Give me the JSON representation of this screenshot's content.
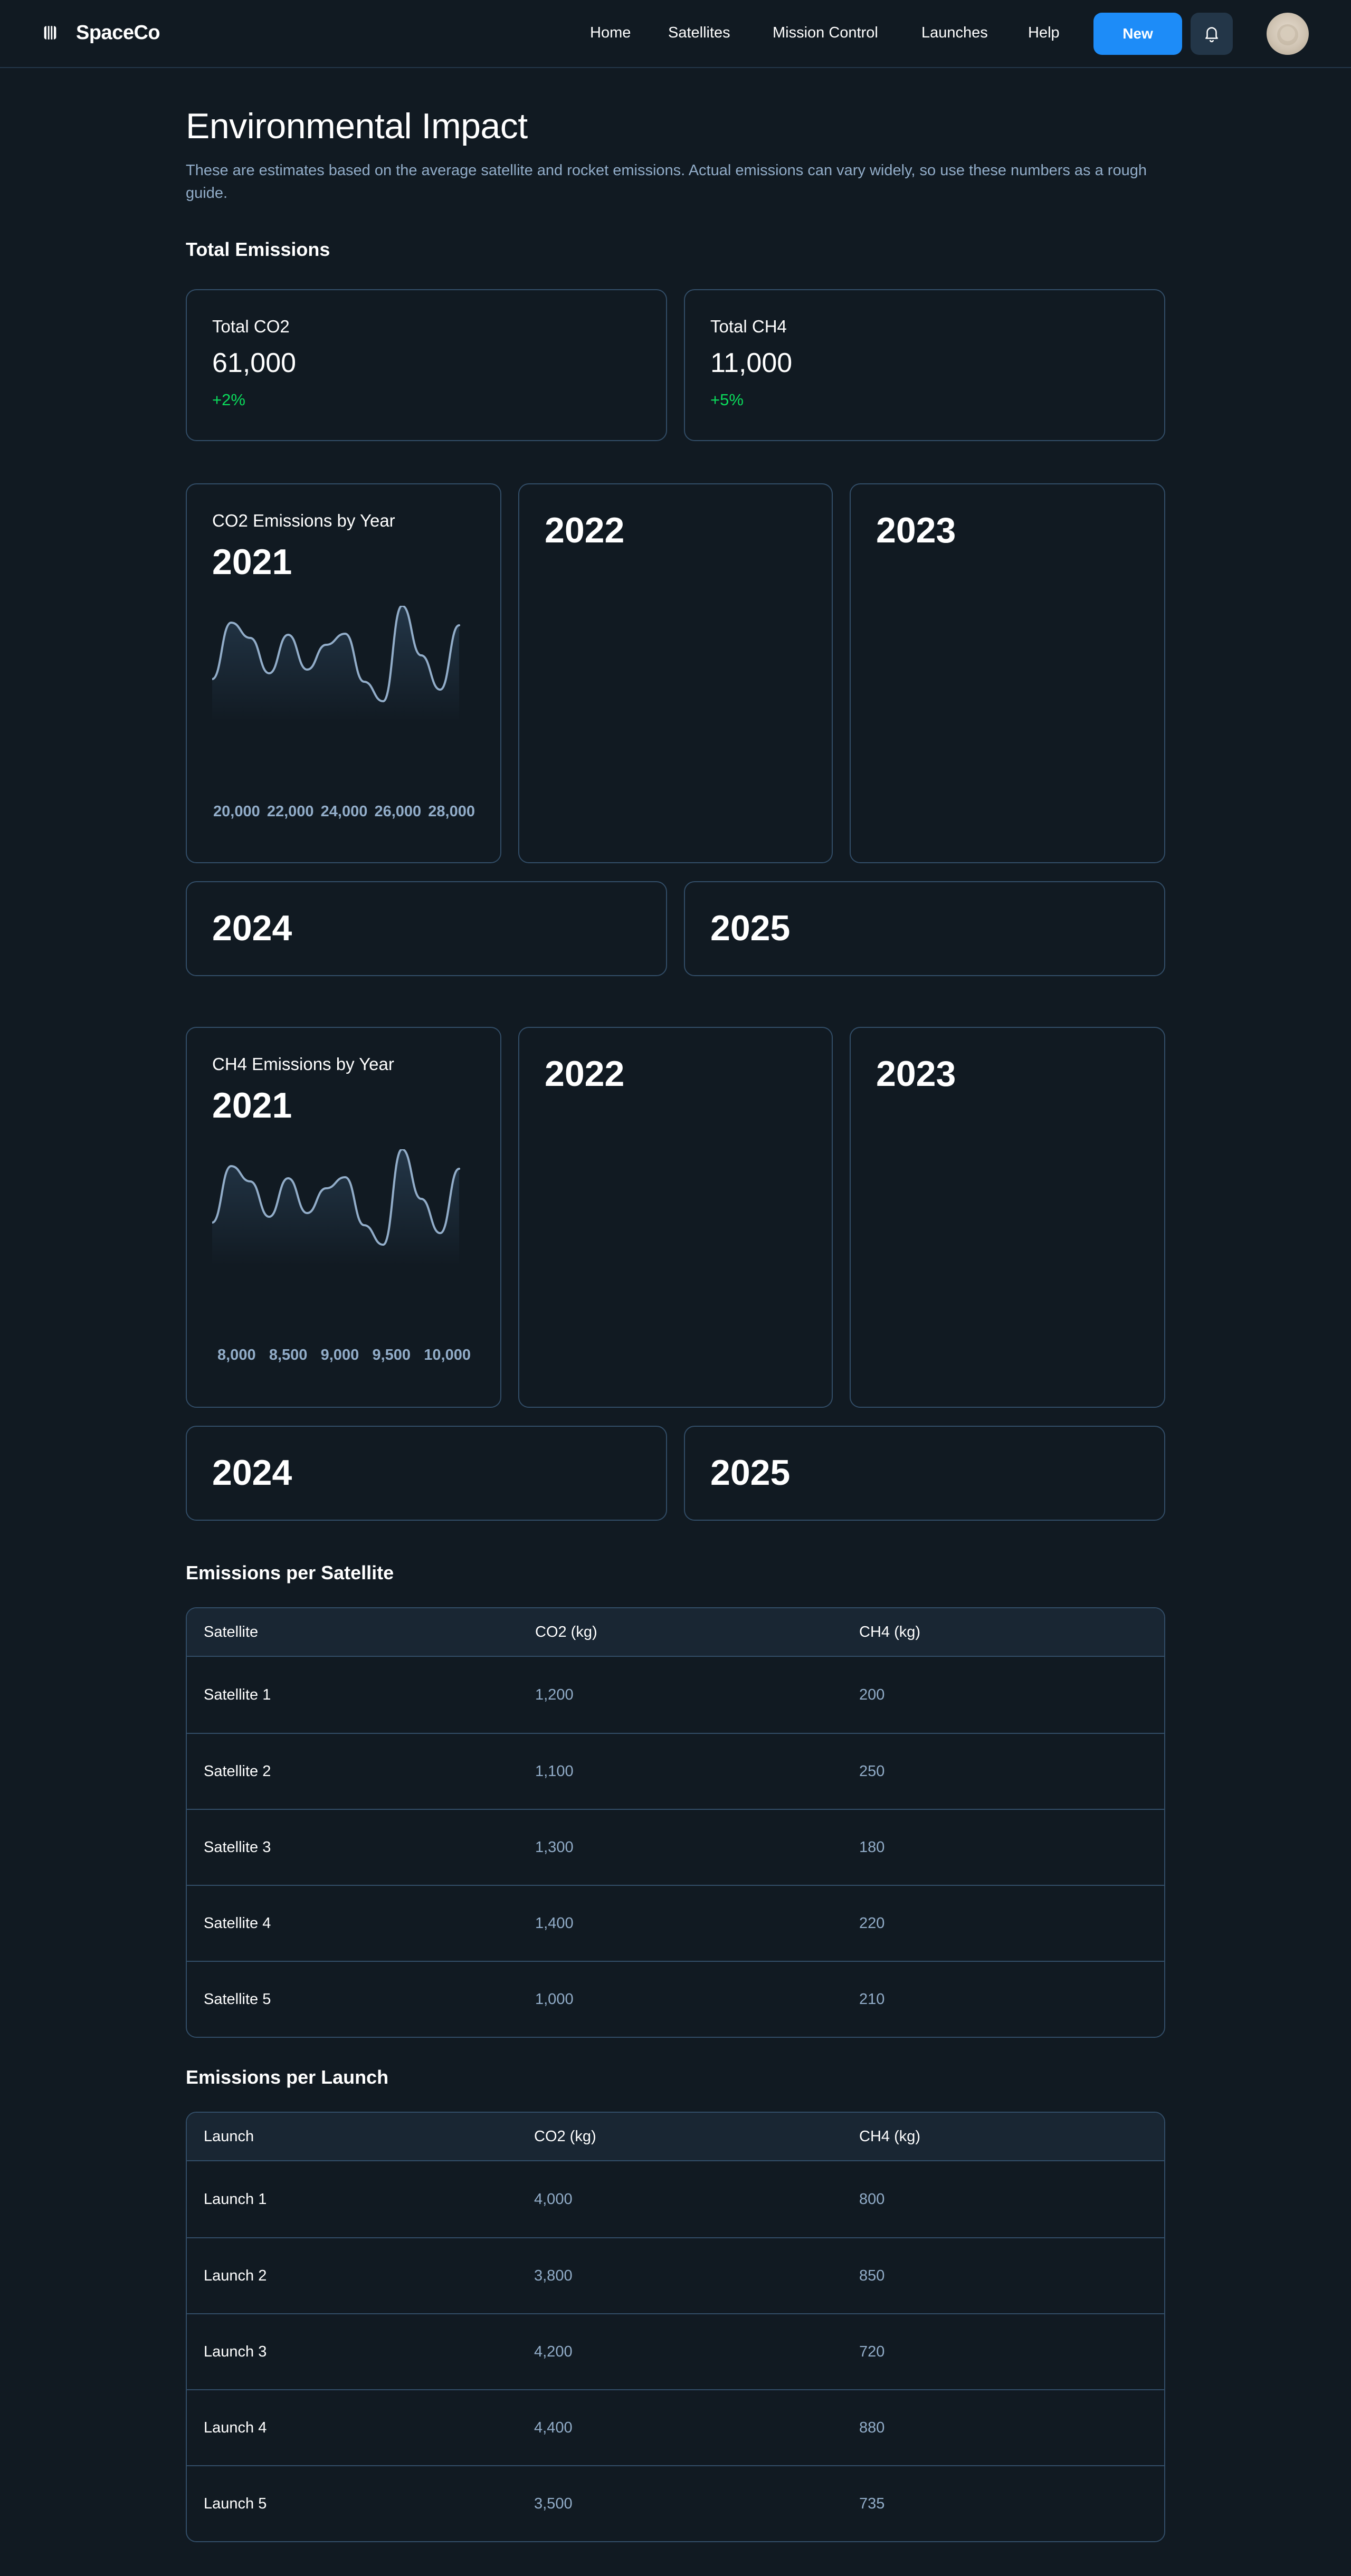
{
  "header": {
    "brand": "SpaceCo",
    "nav": [
      "Home",
      "Satellites",
      "Mission Control",
      "Launches",
      "Help"
    ],
    "new_button": "New"
  },
  "page": {
    "title": "Environmental Impact",
    "description": "These are estimates based on the average satellite and rocket emissions. Actual emissions can vary widely, so use these numbers as a rough guide."
  },
  "totals": {
    "section_title": "Total Emissions",
    "co2": {
      "label": "Total CO2",
      "value": "61,000",
      "change": "+2%"
    },
    "ch4": {
      "label": "Total CH4",
      "value": "11,000",
      "change": "+5%"
    }
  },
  "co2_by_year": {
    "label": "CO2 Emissions by Year",
    "years": [
      "2021",
      "2022",
      "2023",
      "2024",
      "2025"
    ],
    "ticks": [
      "20,000",
      "22,000",
      "24,000",
      "26,000",
      "28,000"
    ]
  },
  "ch4_by_year": {
    "label": "CH4 Emissions by Year",
    "years": [
      "2021",
      "2022",
      "2023",
      "2024",
      "2025"
    ],
    "ticks": [
      "8,000",
      "8,500",
      "9,000",
      "9,500",
      "10,000"
    ]
  },
  "satellite_table": {
    "title": "Emissions per Satellite",
    "headers": [
      "Satellite",
      "CO2 (kg)",
      "CH4 (kg)"
    ],
    "rows": [
      [
        "Satellite 1",
        "1,200",
        "200"
      ],
      [
        "Satellite 2",
        "1,100",
        "250"
      ],
      [
        "Satellite 3",
        "1,300",
        "180"
      ],
      [
        "Satellite 4",
        "1,400",
        "220"
      ],
      [
        "Satellite 5",
        "1,000",
        "210"
      ]
    ]
  },
  "launch_table": {
    "title": "Emissions per Launch",
    "headers": [
      "Launch",
      "CO2 (kg)",
      "CH4 (kg)"
    ],
    "rows": [
      [
        "Launch 1",
        "4,000",
        "800"
      ],
      [
        "Launch 2",
        "3,800",
        "850"
      ],
      [
        "Launch 3",
        "4,200",
        "720"
      ],
      [
        "Launch 4",
        "4,400",
        "880"
      ],
      [
        "Launch 5",
        "3,500",
        "735"
      ]
    ]
  },
  "colors": {
    "background": "#111a22",
    "border": "#324d67",
    "muted_text": "#92adc9",
    "primary": "#1d8cf8",
    "positive": "#0bda5b"
  }
}
